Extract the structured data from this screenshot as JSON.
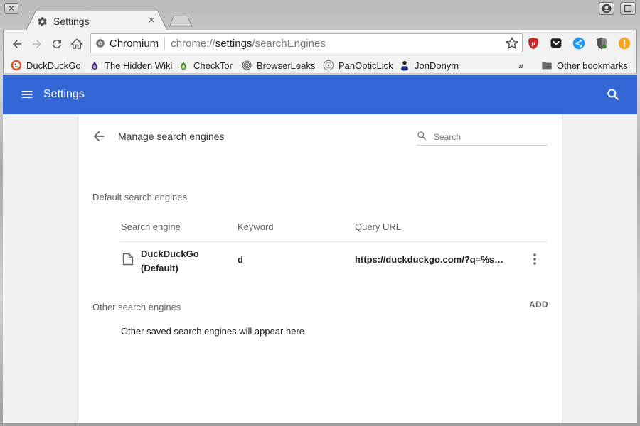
{
  "window": {
    "close_glyph": "✕",
    "user_icon": "account-icon",
    "restore_icon": "restore-icon"
  },
  "tab": {
    "title": "Settings",
    "close_glyph": "×",
    "icon": "gear-icon"
  },
  "omnibox": {
    "site_label": "Chromium",
    "url_prefix": "chrome://",
    "url_host": "settings",
    "url_path": "/searchEngines"
  },
  "extensions": [
    "ublock-icon",
    "pocket-icon",
    "share-icon",
    "privacy-badger-icon",
    "warning-icon"
  ],
  "bookmarks": {
    "items": [
      {
        "label": "DuckDuckGo",
        "icon": "duckduckgo-icon"
      },
      {
        "label": "The Hidden Wiki",
        "icon": "onion-icon"
      },
      {
        "label": "CheckTor",
        "icon": "onion-green-icon"
      },
      {
        "label": "BrowserLeaks",
        "icon": "fingerprint-icon"
      },
      {
        "label": "PanOpticLick",
        "icon": "panopticlick-icon"
      },
      {
        "label": "JonDonym",
        "icon": "jondonym-icon"
      }
    ],
    "overflow": "»",
    "other": "Other bookmarks"
  },
  "appbar": {
    "title": "Settings"
  },
  "section": {
    "title": "Manage search engines",
    "search_placeholder": "Search",
    "default_label": "Default search engines",
    "columns": {
      "engine": "Search engine",
      "keyword": "Keyword",
      "url": "Query URL"
    },
    "default_engine": {
      "name_line1": "DuckDuckGo",
      "name_line2": "(Default)",
      "keyword": "d",
      "url": "https://duckduckgo.com/?q=%s&t=..."
    },
    "other_label": "Other search engines",
    "add_label": "ADD",
    "empty_message": "Other saved search engines will appear here"
  },
  "colors": {
    "appbar": "#3367d6",
    "accent_red": "#d32f2f",
    "accent_orange": "#f5a623"
  }
}
